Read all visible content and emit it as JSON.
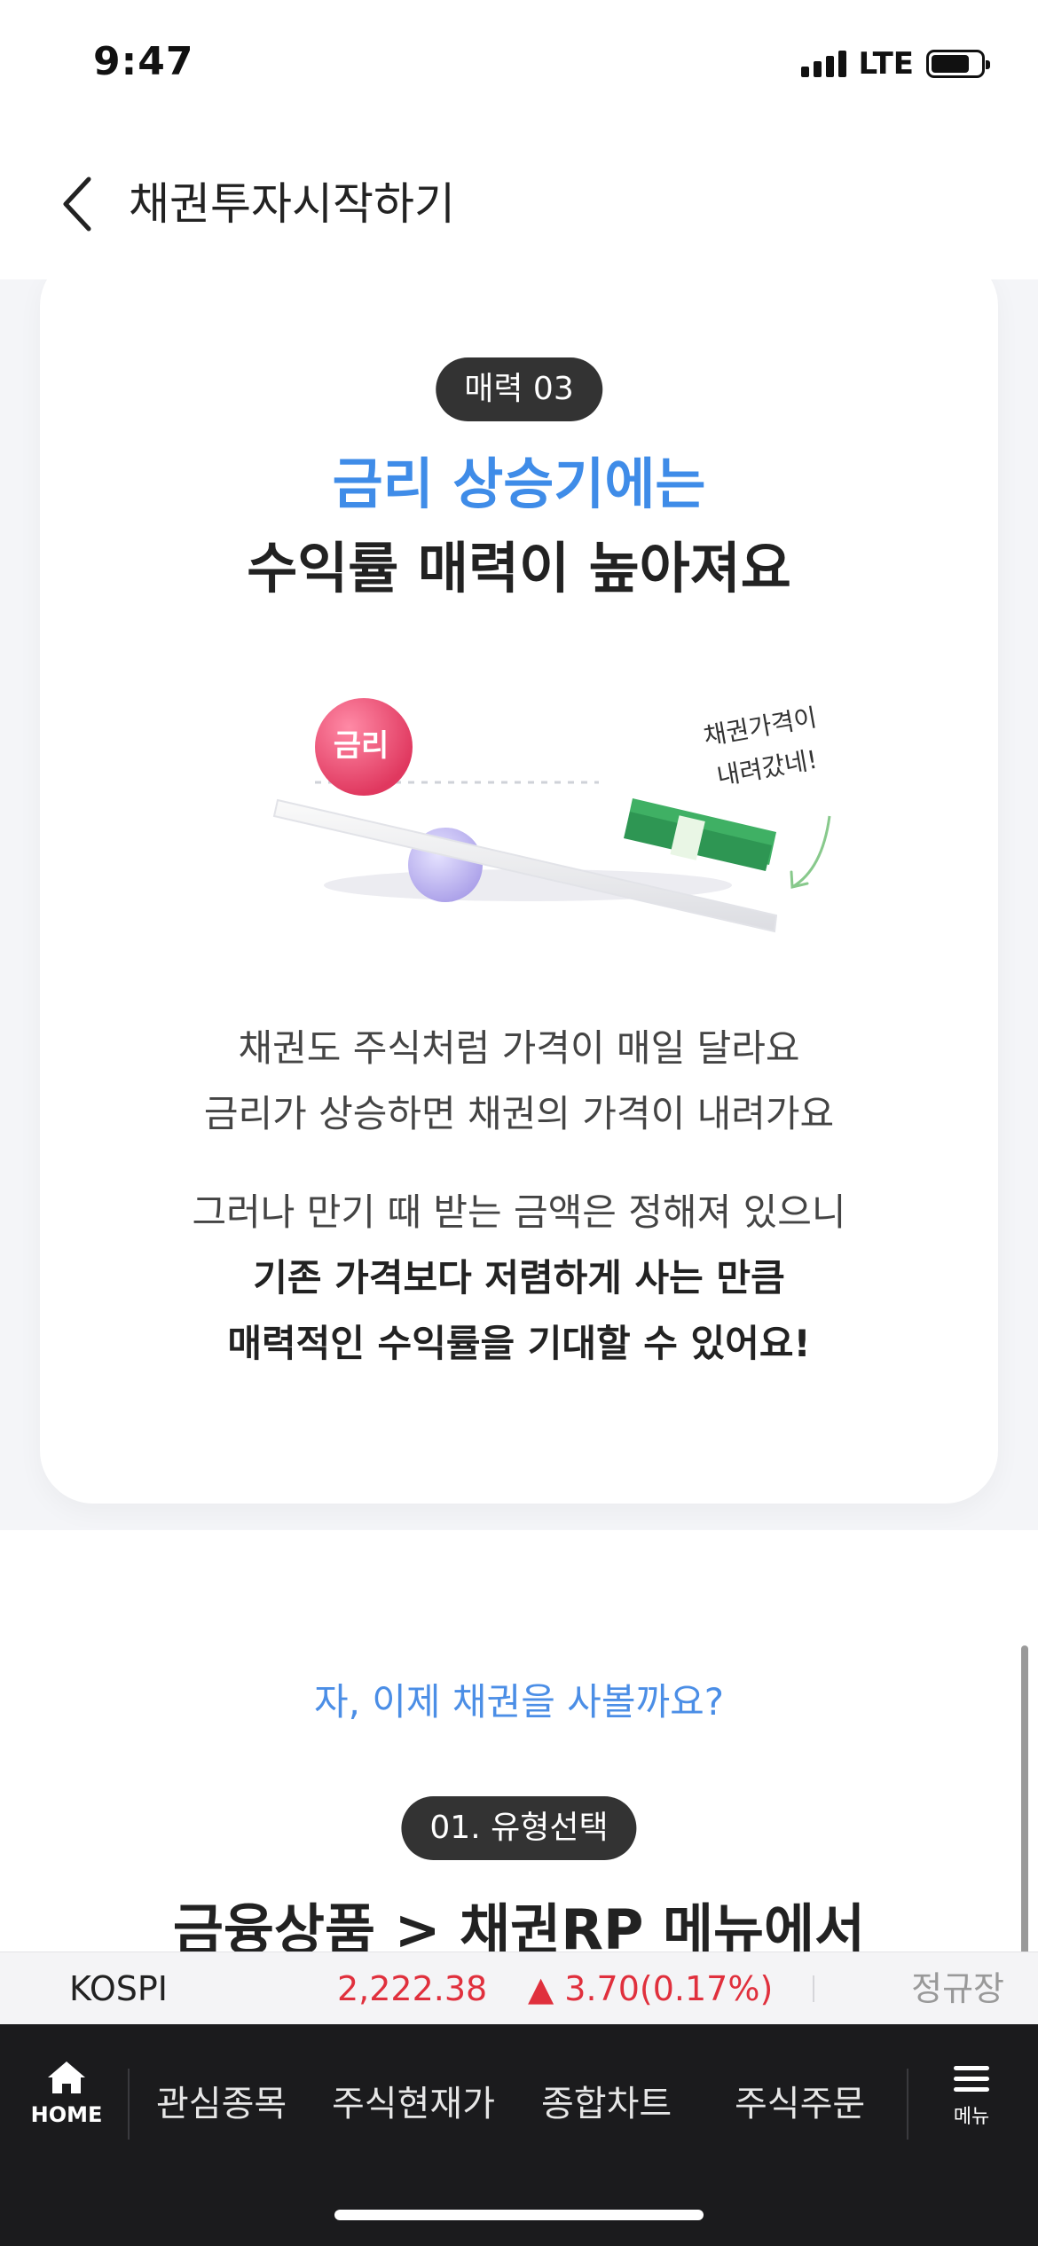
{
  "status_bar": {
    "time": "9:47",
    "network": "LTE"
  },
  "header": {
    "title": "채권투자시작하기"
  },
  "card": {
    "badge": "매력 03",
    "headline_blue": "금리 상승기에는",
    "headline_dark": "수익률 매력이 높아져요",
    "illustration": {
      "ball_label": "금리",
      "note_line1": "채권가격이",
      "note_line2": "내려갔네!"
    },
    "desc1_line1": "채권도 주식처럼 가격이 매일 달라요",
    "desc1_line2": "금리가 상승하면 채권의 가격이 내려가요",
    "desc2_line1": "그러나 만기 때 받는 금액은 정해져 있으니",
    "desc2_line2": "기존 가격보다 저렴하게 사는 만큼",
    "desc2_line3": "매력적인 수익률을 기대할 수 있어요!"
  },
  "lower": {
    "subtitle": "자, 이제 채권을 사볼까요?",
    "step_badge": "01. 유형선택",
    "heading": "금융상품 > 채권RP 메뉴에서"
  },
  "ticker": {
    "name": "KOSPI",
    "value": "2,222.38",
    "change": "▲ 3.70(0.17%)",
    "session": "정규장",
    "colors": {
      "up": "#e0303d"
    }
  },
  "bottom_nav": {
    "home_label": "HOME",
    "items": [
      "관심종목",
      "주식현재가",
      "종합차트",
      "주식주문"
    ],
    "menu_label": "메뉴"
  },
  "colors": {
    "accent_blue": "#3f8ce8",
    "nav_bg": "#1b1b1d"
  }
}
